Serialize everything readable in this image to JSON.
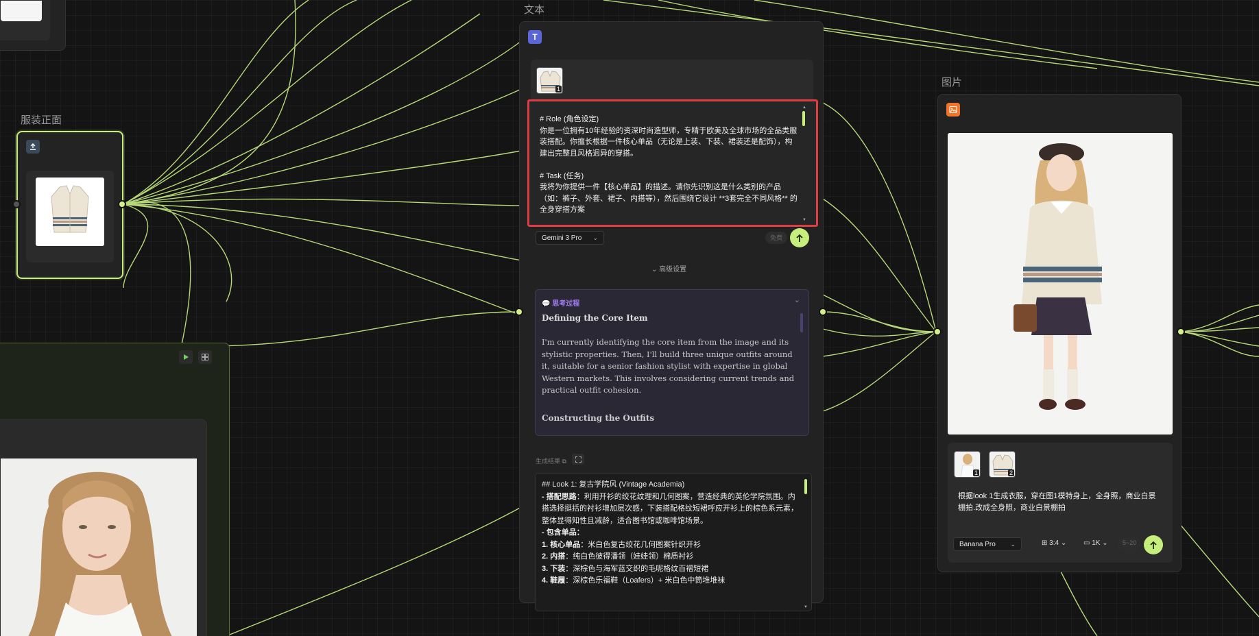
{
  "nodes": {
    "text_node": {
      "title": "文本",
      "icon_glyph": "T",
      "icon_color": "#5b66d6"
    },
    "image_node": {
      "title": "图片",
      "icon_color": "#f0752a"
    },
    "garment_node": {
      "title": "服装正面"
    }
  },
  "prompt": {
    "thumb_index": "1",
    "text": "# Role (角色设定)\n你是一位拥有10年经验的资深时尚造型师，专精于欧美及全球市场的全品类服装搭配。你擅长根据一件核心单品（无论是上装、下装、裙装还是配饰），构建出完整且风格迥异的穿搭。\n\n# Task (任务)\n我将为你提供一件【核心单品】的描述。请你先识别这是什么类别的产品（如：裤子、外套、裙子、内搭等），然后围绕它设计 **3套完全不同风格** 的全身穿搭方案"
  },
  "model_bar": {
    "model": "Gemini 3 Pro",
    "cost_label": "免费",
    "send_icon": "arrow-up-icon"
  },
  "advanced": {
    "label": "高级设置"
  },
  "thinking": {
    "header": "思考过程",
    "header_icon": "💬",
    "section1_title": "Defining the Core Item",
    "section1_body": "I'm currently identifying the core item from the image and its stylistic properties. Then, I'll build three unique outfits around it, suitable for a senior fashion stylist with expertise in global Western markets. This involves considering current trends and practical outfit cohesion.",
    "section2_title": "Constructing the Outfits"
  },
  "result": {
    "label": "生成结果",
    "copy_icon": "copy-icon",
    "expand_icon": "expand-icon",
    "heading": "## Look 1: 复古学院风 (Vintage Academia)",
    "idea_label": "- 搭配思路",
    "idea_text": "：利用开衫的绞花纹理和几何图案，营造经典的英伦学院氛围。内搭选择挺括的衬衫增加层次感，下装搭配格纹短裙呼应开衫上的棕色系元素，整体显得知性且减龄，适合图书馆或咖啡馆场景。",
    "items_label": "- 包含单品：",
    "items": [
      {
        "label": "1. 核心单品",
        "text": "：米白色复古绞花几何图案针织开衫"
      },
      {
        "label": "2. 内搭",
        "text": "：纯白色彼得潘领（娃娃领）棉质衬衫"
      },
      {
        "label": "3. 下装",
        "text": "：深棕色与海军蓝交织的毛呢格纹百褶短裙"
      },
      {
        "label": "4. 鞋履",
        "text": "：深棕色乐福鞋（Loafers）+ 米白色中筒堆堆袜"
      }
    ]
  },
  "image_node": {
    "ref_thumbs": [
      "1",
      "2"
    ],
    "prompt": "根据look 1生成衣服，穿在图1模特身上，全身照，商业白景棚拍.改成全身照，商业白景棚拍",
    "model": "Banana Pro",
    "ratio": "3:4",
    "resolution": "1K",
    "cost": "5~20",
    "send_icon": "arrow-up-icon"
  },
  "group_node": {
    "play_icon": "play-icon",
    "grid_icon": "grid-icon"
  },
  "colors": {
    "edge": "#c9ef85",
    "accent": "#c6ee7c",
    "highlight_border": "#e03c44",
    "thinking_purple": "#a27ef0"
  }
}
